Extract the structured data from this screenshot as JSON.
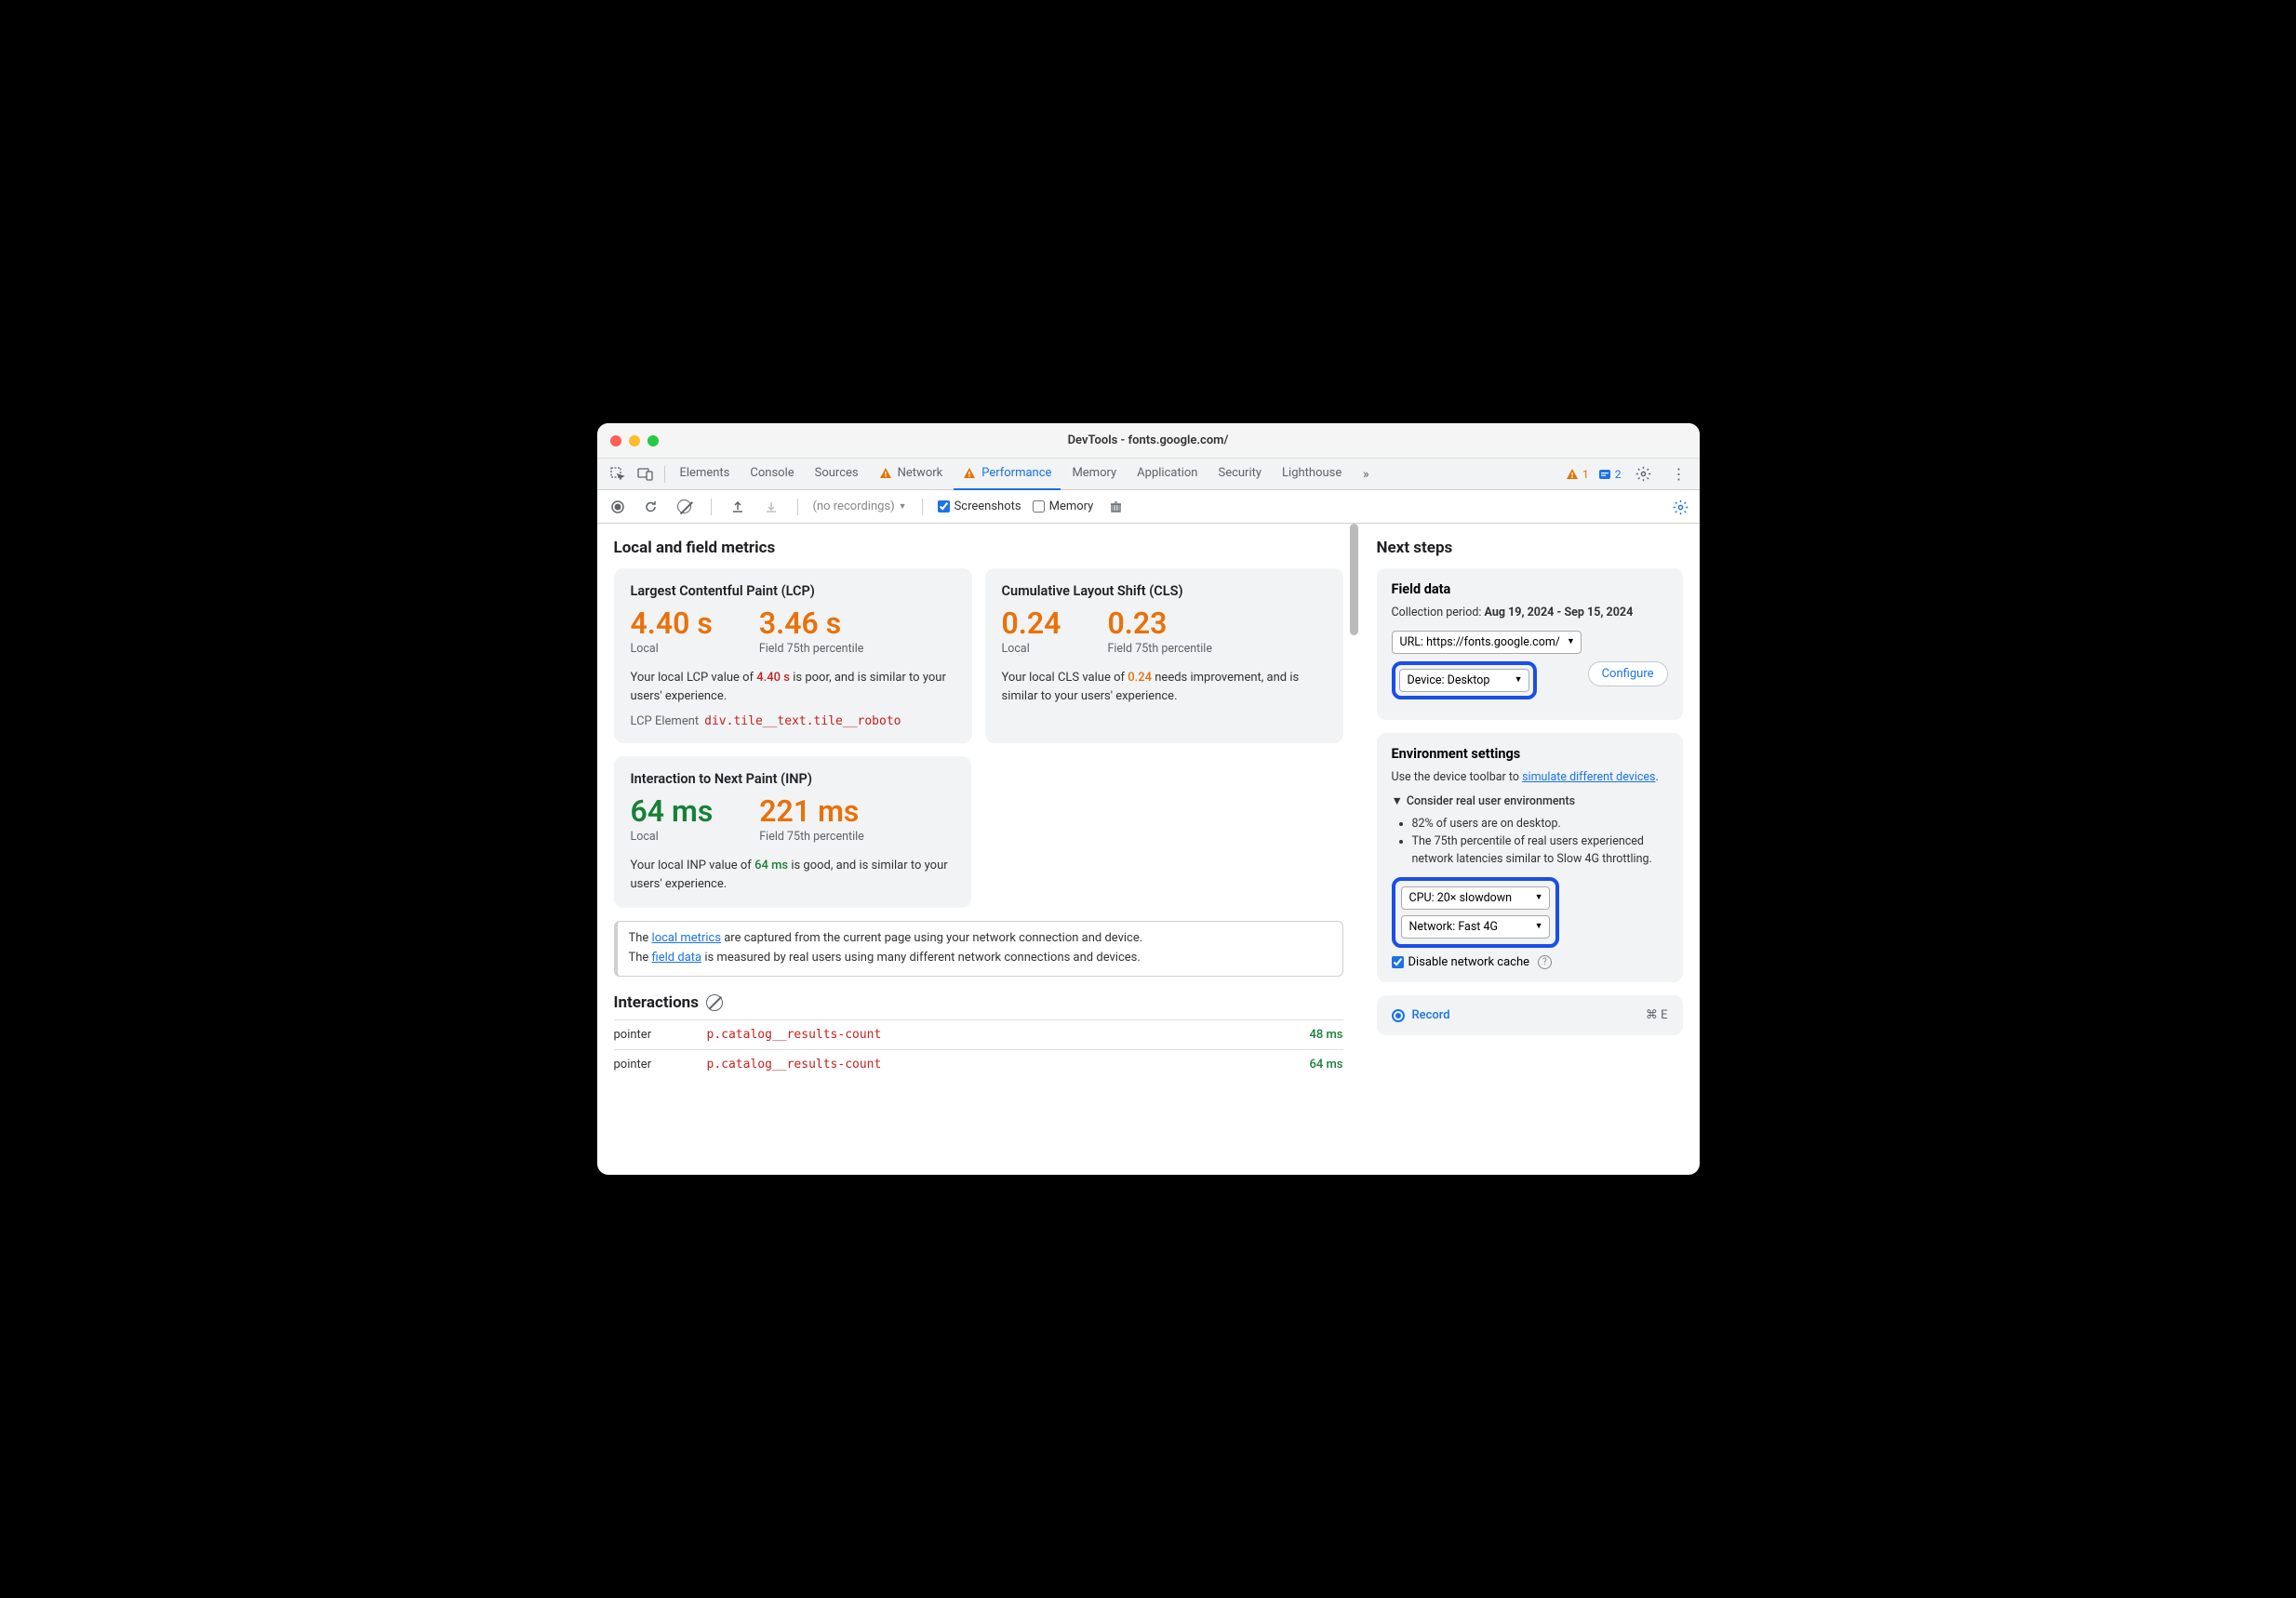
{
  "window_title": "DevTools - fonts.google.com/",
  "tabs": [
    "Elements",
    "Console",
    "Sources",
    "Network",
    "Performance",
    "Memory",
    "Application",
    "Security",
    "Lighthouse"
  ],
  "warn_count": "1",
  "info_count": "2",
  "subbar": {
    "recordings": "(no recordings)",
    "screenshots": "Screenshots",
    "memory": "Memory"
  },
  "left": {
    "heading": "Local and field metrics",
    "lcp": {
      "title": "Largest Contentful Paint (LCP)",
      "local_val": "4.40 s",
      "local_lbl": "Local",
      "field_val": "3.46 s",
      "field_lbl": "Field 75th percentile",
      "note_a": "Your local LCP value of ",
      "note_b": "4.40 s",
      "note_c": " is poor, and is similar to your users' experience.",
      "el_lbl": "LCP Element",
      "el_val": "div.tile__text.tile__roboto"
    },
    "cls": {
      "title": "Cumulative Layout Shift (CLS)",
      "local_val": "0.24",
      "local_lbl": "Local",
      "field_val": "0.23",
      "field_lbl": "Field 75th percentile",
      "note_a": "Your local CLS value of ",
      "note_b": "0.24",
      "note_c": " needs improvement, and is similar to your users' experience."
    },
    "inp": {
      "title": "Interaction to Next Paint (INP)",
      "local_val": "64 ms",
      "local_lbl": "Local",
      "field_val": "221 ms",
      "field_lbl": "Field 75th percentile",
      "note_a": "Your local INP value of ",
      "note_b": "64 ms",
      "note_c": " is good, and is similar to your users' experience."
    },
    "info": {
      "a": "The ",
      "link1": "local metrics",
      "b": " are captured from the current page using your network connection and device.",
      "c": "The ",
      "link2": "field data",
      "d": " is measured by real users using many different network connections and devices."
    },
    "interactions": {
      "heading": "Interactions",
      "rows": [
        {
          "type": "pointer",
          "el": "p.catalog__results-count",
          "time": "48 ms"
        },
        {
          "type": "pointer",
          "el": "p.catalog__results-count",
          "time": "64 ms"
        }
      ]
    }
  },
  "right": {
    "heading": "Next steps",
    "field": {
      "title": "Field data",
      "period_lbl": "Collection period: ",
      "period_val": "Aug 19, 2024 - Sep 15, 2024",
      "url": "URL: https://fonts.google.com/",
      "device": "Device: Desktop",
      "configure": "Configure"
    },
    "env": {
      "title": "Environment settings",
      "sub_a": "Use the device toolbar to ",
      "sub_link": "simulate different devices",
      "sub_b": ".",
      "disclosure": "Consider real user environments",
      "b1": "82% of users are on desktop.",
      "b2": "The 75th percentile of real users experienced network latencies similar to Slow 4G throttling.",
      "cpu": "CPU: 20× slowdown",
      "net": "Network: Fast 4G",
      "cache": "Disable network cache"
    },
    "record": {
      "label": "Record",
      "shortcut": "⌘ E"
    }
  }
}
